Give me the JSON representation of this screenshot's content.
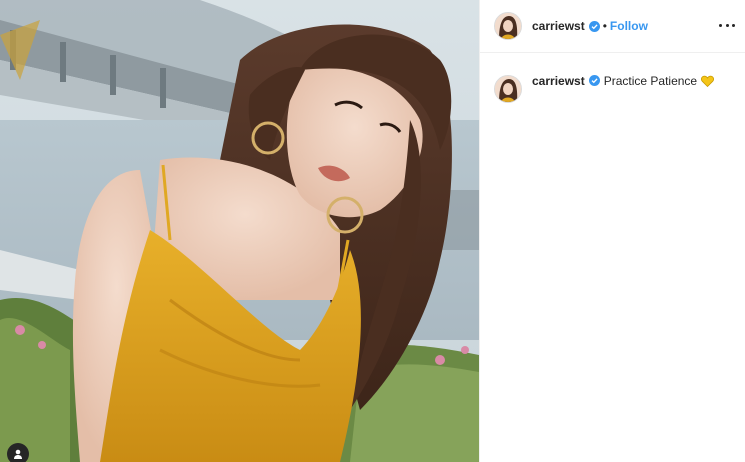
{
  "post": {
    "username": "carriewst",
    "follow_label": "Follow",
    "separator": "•",
    "caption": "Practice Patience",
    "caption_emoji": "yellow-heart",
    "verified": true
  },
  "colors": {
    "follow": "#3897f0",
    "verified_badge": "#3897f0",
    "dress": "#e0a823",
    "heart": "#f5c518"
  },
  "icons": {
    "more": "more-options-icon",
    "tag": "user-tag-icon",
    "verified": "verified-badge-icon"
  }
}
